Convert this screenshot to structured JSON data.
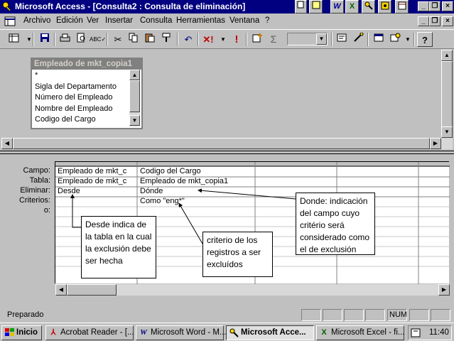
{
  "window": {
    "title": "Microsoft Access - [Consulta2 : Consulta de eliminación]",
    "office_icons": [
      "W",
      "X"
    ]
  },
  "menu": {
    "items": [
      "Archivo",
      "Edición",
      "Ver",
      "Insertar",
      "Consulta",
      "Herramientas",
      "Ventana",
      "?"
    ]
  },
  "field_list": {
    "title": "Empleado de mkt_copia1",
    "fields": [
      "*",
      "Sigla del Departamento",
      "Número del Empleado",
      "Nombre del Empleado",
      "Codigo del Cargo"
    ]
  },
  "grid": {
    "row_labels": [
      "Campo:",
      "Tabla:",
      "Eliminar:",
      "Criterios:",
      "o:"
    ],
    "columns": [
      {
        "campo": "Empleado de mkt_c",
        "tabla": "Empleado de mkt_c",
        "eliminar": "Desde",
        "criterios": ""
      },
      {
        "campo": "Codigo del Cargo",
        "tabla": "Empleado de mkt_copia1",
        "eliminar": "Dónde",
        "criterios": "Como \"eng*\""
      }
    ]
  },
  "callouts": {
    "desde": "Desde indica de la tabla en la cual la exclusión debe ser hecha",
    "criterio": "criterio de los registros a ser excluídos",
    "donde": "Donde: indicación del campo cuyo critério será considerado como el de exclusión"
  },
  "status": {
    "text": "Preparado",
    "num": "NUM"
  },
  "taskbar": {
    "start": "Inicio",
    "tasks": [
      "Acrobat Reader - [...",
      "Microsoft Word - M...",
      "Microsoft Acce...",
      "Microsoft Excel - fi..."
    ],
    "clock": "11:40"
  },
  "colors": {
    "titlebar": "#000080",
    "face": "#c0c0c0",
    "callout_bg": "#ffffff"
  }
}
